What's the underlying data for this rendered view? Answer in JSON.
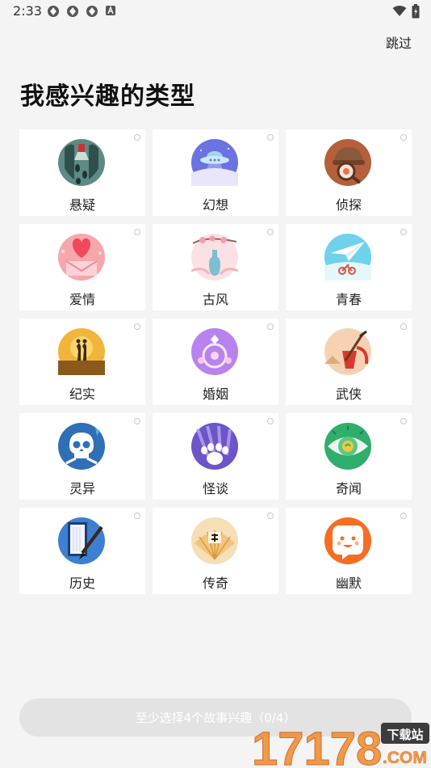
{
  "status_bar": {
    "time": "2:33"
  },
  "header": {
    "skip_label": "跳过",
    "title": "我感兴趣的类型"
  },
  "genres": [
    {
      "label": "悬疑",
      "icon": "suspense-icon"
    },
    {
      "label": "幻想",
      "icon": "fantasy-icon"
    },
    {
      "label": "侦探",
      "icon": "detective-icon"
    },
    {
      "label": "爱情",
      "icon": "romance-icon"
    },
    {
      "label": "古风",
      "icon": "ancient-style-icon"
    },
    {
      "label": "青春",
      "icon": "youth-icon"
    },
    {
      "label": "纪实",
      "icon": "documentary-icon"
    },
    {
      "label": "婚姻",
      "icon": "marriage-icon"
    },
    {
      "label": "武侠",
      "icon": "martial-arts-icon"
    },
    {
      "label": "灵异",
      "icon": "supernatural-icon"
    },
    {
      "label": "怪谈",
      "icon": "weird-tales-icon"
    },
    {
      "label": "奇闻",
      "icon": "strange-news-icon"
    },
    {
      "label": "历史",
      "icon": "history-icon"
    },
    {
      "label": "传奇",
      "icon": "legend-icon"
    },
    {
      "label": "幽默",
      "icon": "humor-icon"
    }
  ],
  "footer": {
    "confirm_label": "至少选择4个故事兴趣（0/4）"
  },
  "watermark": {
    "number": "17178",
    "tag": "下载站",
    "domain": ".COM"
  },
  "colors": {
    "background": "#f4f4f4",
    "card": "#ffffff",
    "button_disabled": "#e3e3e3"
  }
}
